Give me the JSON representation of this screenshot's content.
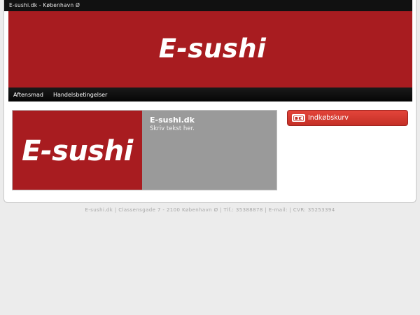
{
  "topbar": {
    "text": "E-sushi.dk - København Ø"
  },
  "banner": {
    "logo_text": "E-sushi"
  },
  "nav": {
    "items": [
      {
        "label": "Aftensmad"
      },
      {
        "label": "Handelsbetingelser"
      }
    ]
  },
  "feature": {
    "logo_text": "E-sushi",
    "title": "E-sushi.dk",
    "description": "Skriv tekst her."
  },
  "cart": {
    "label": "Indkøbskurv",
    "icon": "dankort-icon"
  },
  "footer": {
    "text": "E-sushi.dk | Classensgade 7 - 2100 København Ø | Tlf.: 35388878 | E-mail: | CVR: 35253394"
  },
  "colors": {
    "brand_red": "#a81c20",
    "button_red": "#d63a30",
    "topbar": "#111111",
    "panel_gray": "#9a9a9a"
  }
}
